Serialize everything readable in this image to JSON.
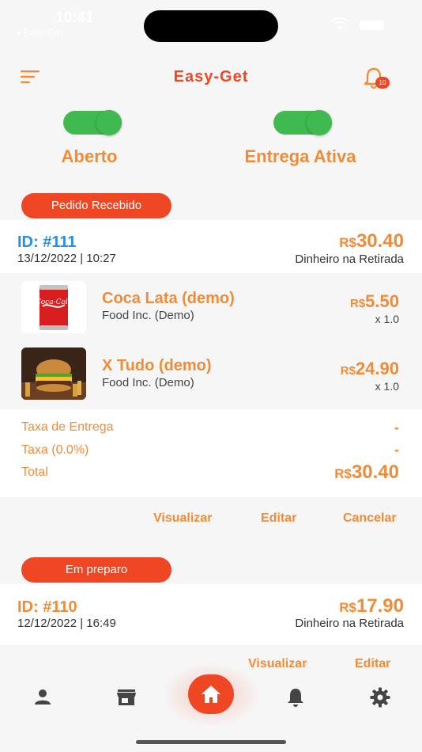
{
  "status_bar": {
    "time": "10:41",
    "back_app": "◂ Easy-Get"
  },
  "header": {
    "title": "Easy-Get",
    "notification_count": "10"
  },
  "toggles": [
    {
      "label": "Aberto",
      "on": true
    },
    {
      "label": "Entrega Ativa",
      "on": true
    }
  ],
  "orders": [
    {
      "status": "Pedido Recebido",
      "id": "ID: #111",
      "id_color": "#2a8fe0",
      "date": "13/12/2022 | 10:27",
      "currency": "R$",
      "total": "30.40",
      "payment": "Dinheiro na Retirada",
      "items": [
        {
          "name": "Coca Lata (demo)",
          "vendor": "Food Inc. (Demo)",
          "currency": "R$",
          "price": "5.50",
          "qty": "x 1.0"
        },
        {
          "name": "X Tudo (demo)",
          "vendor": "Food Inc. (Demo)",
          "currency": "R$",
          "price": "24.90",
          "qty": "x 1.0"
        }
      ],
      "summary": {
        "delivery_label": "Taxa de Entrega",
        "delivery_value": "-",
        "tax_label": "Taxa (0.0%)",
        "tax_value": "-",
        "total_label": "Total",
        "total_currency": "R$",
        "total_value": "30.40"
      },
      "actions": {
        "view": "Visualizar",
        "edit": "Editar",
        "cancel": "Cancelar"
      }
    },
    {
      "status": "Em preparo",
      "id": "ID: #110",
      "id_color": "#ef8c3a",
      "date": "12/12/2022 | 16:49",
      "currency": "R$",
      "total": "17.90",
      "payment": "Dinheiro na Retirada",
      "actions": {
        "view": "Visualizar",
        "edit": "Editar"
      }
    }
  ],
  "tabbar": {
    "icons": [
      "person-icon",
      "store-icon",
      "home-icon",
      "bell-icon",
      "gear-icon"
    ]
  },
  "colors": {
    "accent": "#ef4623",
    "orange": "#ef8c3a",
    "green": "#3fb950",
    "blue": "#2a8fe0"
  }
}
